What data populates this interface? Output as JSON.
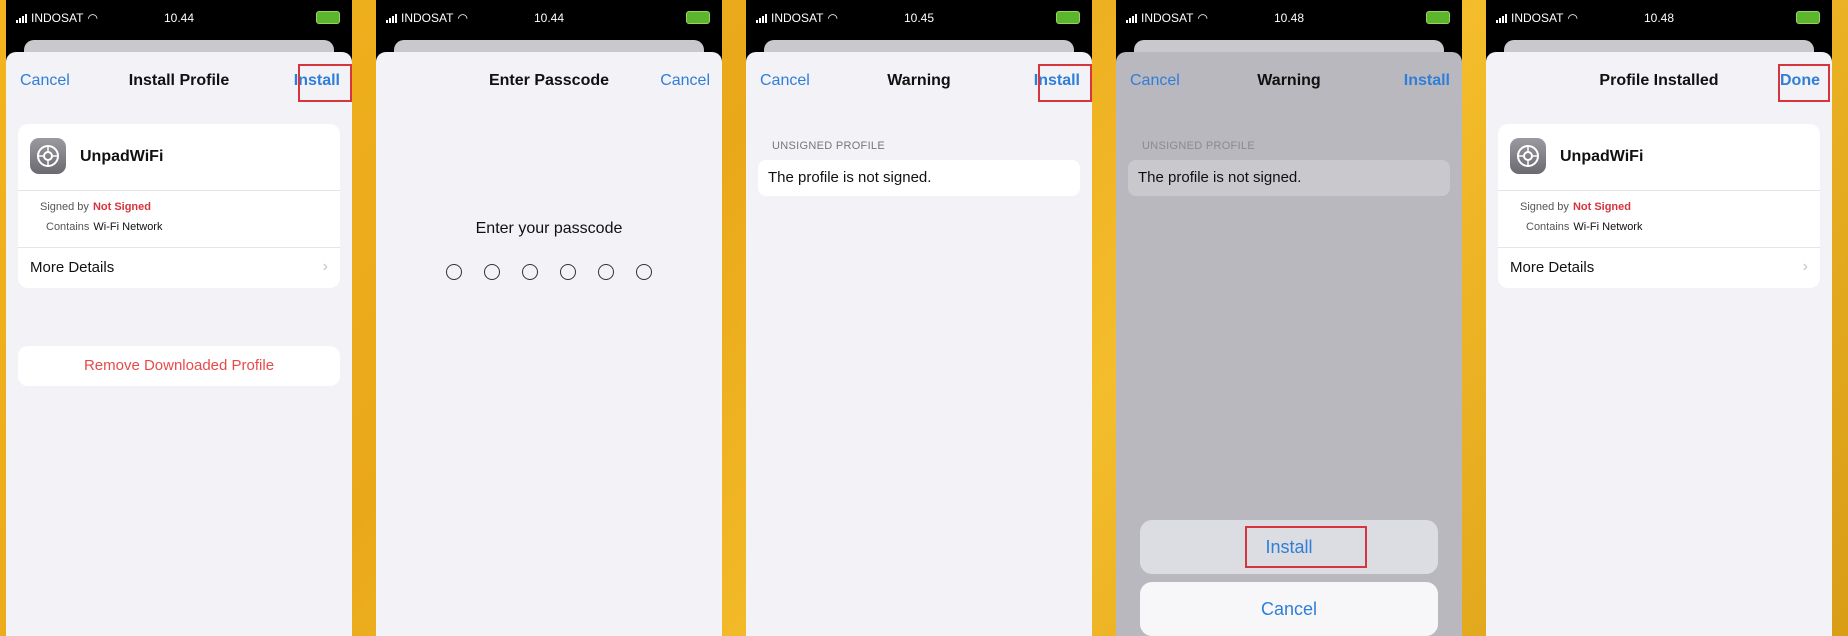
{
  "status": {
    "carrier": "INDOSAT",
    "times": [
      "10.44",
      "10.44",
      "10.45",
      "10.48",
      "10.48"
    ]
  },
  "screen1": {
    "cancel": "Cancel",
    "title": "Install Profile",
    "install": "Install",
    "profile_name": "UnpadWiFi",
    "signed_by_label": "Signed by",
    "signed_by_value": "Not Signed",
    "contains_label": "Contains",
    "contains_value": "Wi-Fi Network",
    "more_details": "More Details",
    "remove": "Remove Downloaded Profile"
  },
  "screen2": {
    "title": "Enter Passcode",
    "cancel": "Cancel",
    "prompt": "Enter your passcode",
    "digits": 6
  },
  "screen3": {
    "cancel": "Cancel",
    "title": "Warning",
    "install": "Install",
    "section": "UNSIGNED PROFILE",
    "message": "The profile is not signed."
  },
  "screen4": {
    "cancel": "Cancel",
    "title": "Warning",
    "install": "Install",
    "section": "UNSIGNED PROFILE",
    "message": "The profile is not signed.",
    "sheet_install": "Install",
    "sheet_cancel": "Cancel"
  },
  "screen5": {
    "title": "Profile Installed",
    "done": "Done",
    "profile_name": "UnpadWiFi",
    "signed_by_label": "Signed by",
    "signed_by_value": "Not Signed",
    "contains_label": "Contains",
    "contains_value": "Wi-Fi Network",
    "more_details": "More Details"
  },
  "colors": {
    "accent": "#2f7ed8",
    "destructive": "#e84a4a",
    "highlight": "#d6353e",
    "background": "#f2b41f"
  }
}
